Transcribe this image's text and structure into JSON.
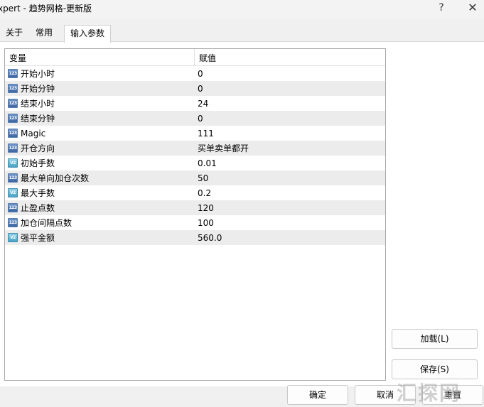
{
  "window": {
    "title": "xpert - 趋势网格-更新版",
    "help_glyph": "?",
    "close_glyph": "✕"
  },
  "tabs": [
    {
      "label": "关于",
      "active": false
    },
    {
      "label": "常用",
      "active": false
    },
    {
      "label": "输入参数",
      "active": true
    }
  ],
  "grid": {
    "headers": [
      "变量",
      "赋值"
    ],
    "rows": [
      {
        "icon": "int",
        "icon_text": "123",
        "name": "开始小时",
        "value": "0"
      },
      {
        "icon": "int",
        "icon_text": "123",
        "name": "开始分钟",
        "value": "0"
      },
      {
        "icon": "int",
        "icon_text": "123",
        "name": "结束小时",
        "value": "24"
      },
      {
        "icon": "int",
        "icon_text": "123",
        "name": "结束分钟",
        "value": "0"
      },
      {
        "icon": "int",
        "icon_text": "123",
        "name": "Magic",
        "value": "111"
      },
      {
        "icon": "int",
        "icon_text": "123",
        "name": "开仓方向",
        "value": "买单卖单都开"
      },
      {
        "icon": "dbl",
        "icon_text": "V2",
        "name": "初始手数",
        "value": "0.01"
      },
      {
        "icon": "int",
        "icon_text": "123",
        "name": "最大单向加仓次数",
        "value": "50"
      },
      {
        "icon": "dbl",
        "icon_text": "V2",
        "name": "最大手数",
        "value": "0.2"
      },
      {
        "icon": "int",
        "icon_text": "123",
        "name": "止盈点数",
        "value": "120"
      },
      {
        "icon": "int",
        "icon_text": "123",
        "name": "加仓间隔点数",
        "value": "100"
      },
      {
        "icon": "dbl",
        "icon_text": "V2",
        "name": "强平金额",
        "value": "560.0"
      }
    ]
  },
  "buttons": {
    "load": "加载(L)",
    "save": "保存(S)",
    "ok": "确定",
    "cancel": "取消",
    "reset": "重置"
  },
  "watermark": "汇探网"
}
